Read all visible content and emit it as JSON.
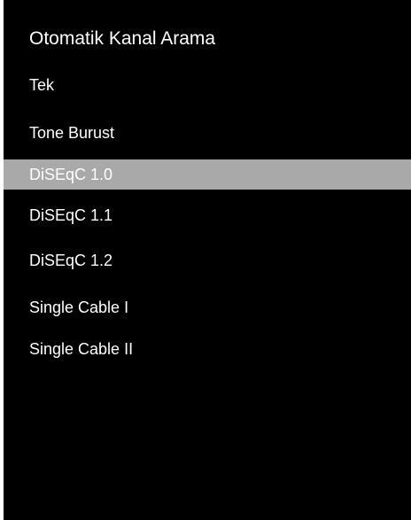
{
  "panel": {
    "title": "Otomatik Kanal Arama",
    "background_color": "#000000",
    "highlight_color": "#a9a9a9",
    "text_color": "#ffffff"
  },
  "menu": {
    "selected_index": 2,
    "items": [
      {
        "label": "Tek"
      },
      {
        "label": "Tone Burust"
      },
      {
        "label": "DiSEqC 1.0"
      },
      {
        "label": "DiSEqC 1.1"
      },
      {
        "label": "DiSEqC 1.2"
      },
      {
        "label": "Single Cable I"
      },
      {
        "label": "Single Cable II"
      }
    ]
  }
}
